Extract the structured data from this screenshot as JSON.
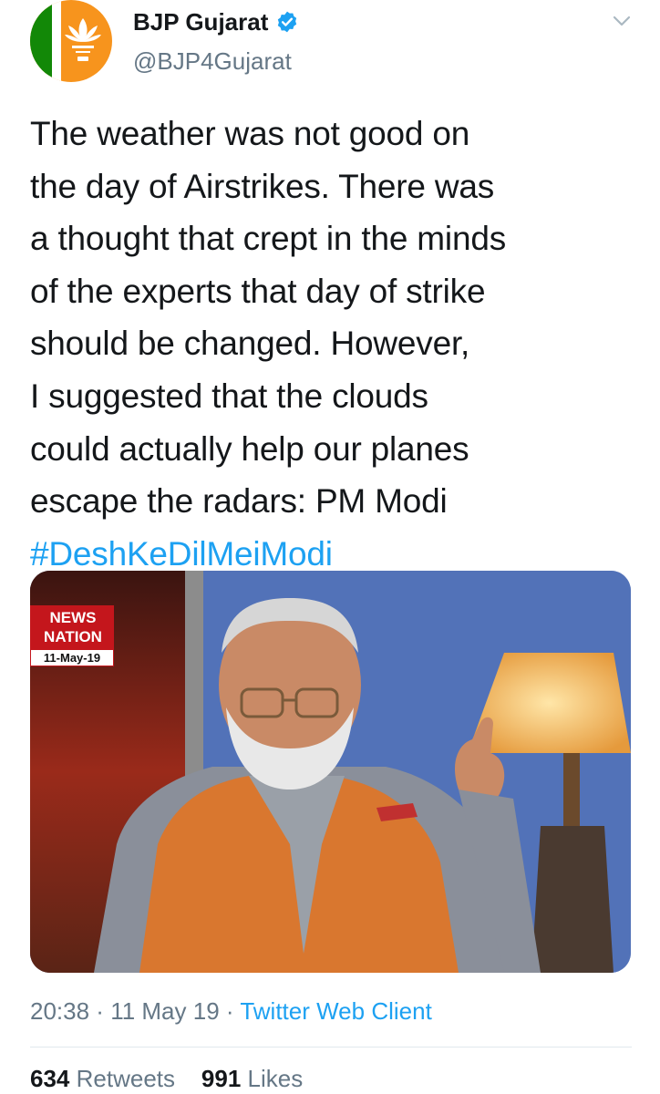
{
  "author": {
    "display_name": "BJP Gujarat",
    "handle": "@BJP4Gujarat",
    "verified": true
  },
  "tweet": {
    "text_lines": [
      "The weather was not good on",
      "the day of Airstrikes. There was",
      "a thought that crept in the minds",
      "of the experts that day of strike",
      "should be changed. However,",
      "I suggested that the clouds",
      "could actually help our planes",
      "escape the radars: PM Modi"
    ],
    "hashtag": "#DeshKeDilMeiModi"
  },
  "media": {
    "channel_logo": "NEWS NATION",
    "date_tag": "11-May-19"
  },
  "meta": {
    "time": "20:38",
    "date": "11 May 19",
    "separator": " · ",
    "source": "Twitter Web Client"
  },
  "stats": {
    "retweets": "634",
    "retweets_label": "Retweets",
    "likes": "991",
    "likes_label": "Likes"
  },
  "colors": {
    "link": "#1da1f2",
    "secondary_text": "#657786",
    "verified": "#1da1f2",
    "brand_orange": "#f7941d"
  },
  "icons": [
    "verified-badge-icon",
    "chevron-down-icon"
  ]
}
